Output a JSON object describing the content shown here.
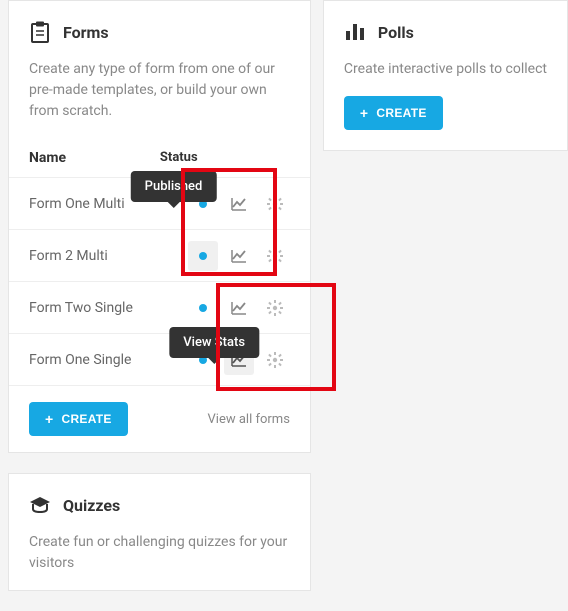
{
  "forms": {
    "title": "Forms",
    "description": "Create any type of form from one of our pre-made templates, or build your own from scratch.",
    "columns": {
      "name": "Name",
      "status": "Status"
    },
    "rows": [
      {
        "name": "Form One Multi"
      },
      {
        "name": "Form 2 Multi"
      },
      {
        "name": "Form Two Single"
      },
      {
        "name": "Form One Single"
      }
    ],
    "tooltips": {
      "published": "Published",
      "view_stats": "View Stats"
    },
    "create_label": "CREATE",
    "view_all_label": "View all forms"
  },
  "quizzes": {
    "title": "Quizzes",
    "description": "Create fun or challenging quizzes for your visitors"
  },
  "polls": {
    "title": "Polls",
    "description": "Create interactive polls to collect",
    "create_label": "CREATE"
  },
  "colors": {
    "accent": "#17a8e3",
    "annotation": "#e30613"
  }
}
